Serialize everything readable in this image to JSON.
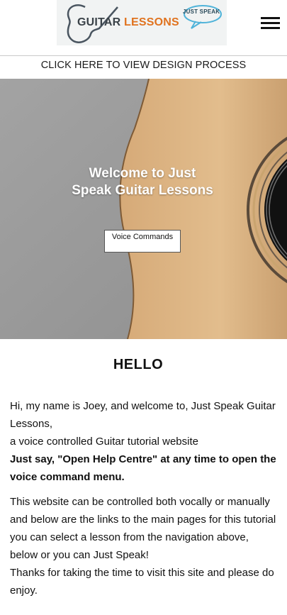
{
  "logo": {
    "text_part1": "GUITAR",
    "text_part2": "LESSONS",
    "bubble_text": "JUST SPEAK",
    "color_dark": "#3a4248",
    "color_accent": "#e0731f"
  },
  "nav": {
    "menu_icon": "hamburger-menu-icon"
  },
  "design_link": {
    "label": "CLICK HERE TO VIEW DESIGN PROCESS"
  },
  "hero": {
    "title": "Welcome to Just Speak Guitar Lessons",
    "button_label": "Voice Commands"
  },
  "main": {
    "heading": "HELLO",
    "intro_1": "Hi, my name is Joey, and welcome to, Just Speak Guitar Lessons,",
    "intro_2": "a voice controlled Guitar tutorial website",
    "instruction": "Just say, \"Open Help Centre\" at any time to open the voice command menu.",
    "body": "This website can be controlled both vocally or manually and below are the links to the main pages for this tutorial you can select a lesson from the navigation above, below or you can Just Speak!",
    "thanks": "Thanks for taking the time to visit this site and please do enjoy."
  }
}
